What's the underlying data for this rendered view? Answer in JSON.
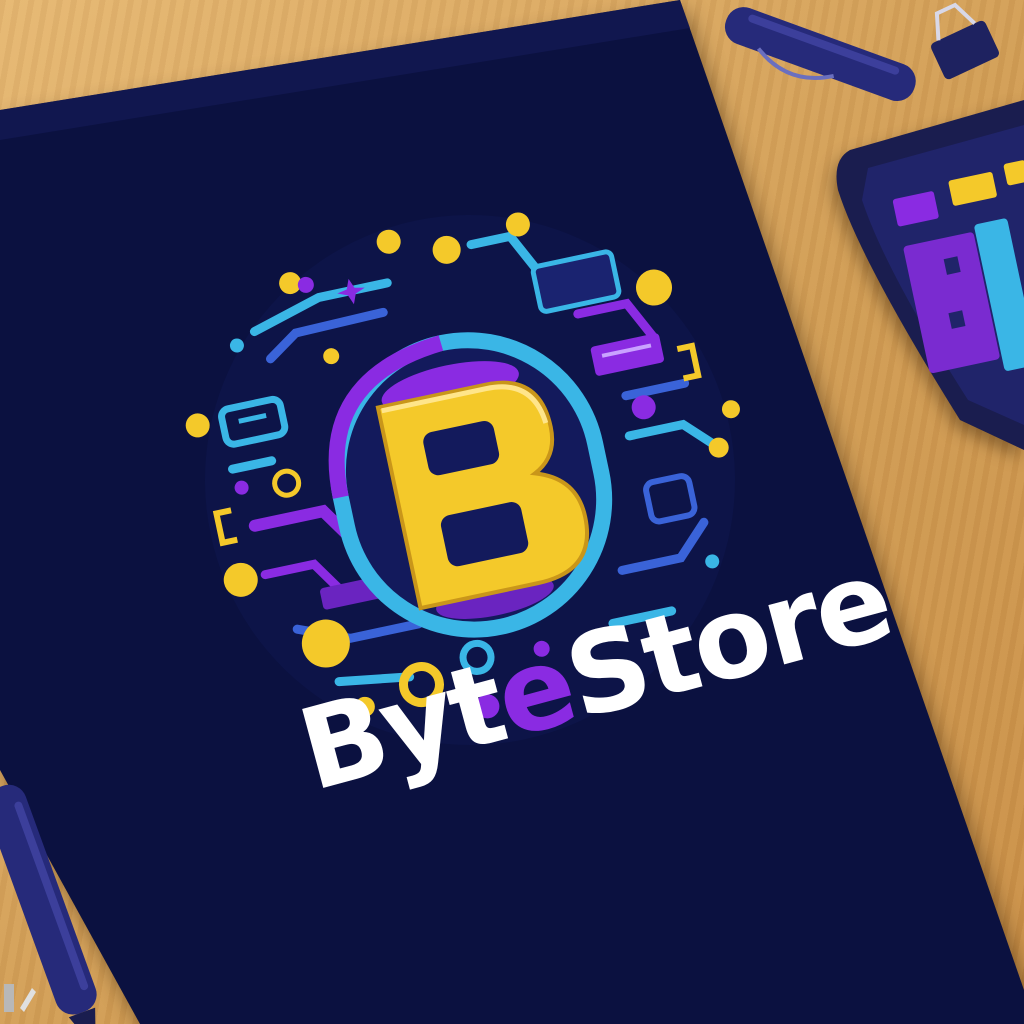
{
  "logo": {
    "letter": "B",
    "wordmark_parts": [
      "Byt",
      "e",
      "Store"
    ]
  },
  "colors": {
    "poster": "#0b1140",
    "poster_edge": "#141a55",
    "yellow": "#f4c92a",
    "purple": "#8a2be2",
    "cyan": "#3ab6e6",
    "blue": "#3a63d8",
    "wordmark": "#ffffff",
    "desk": "#d9a960",
    "pen": "#262a7a"
  }
}
